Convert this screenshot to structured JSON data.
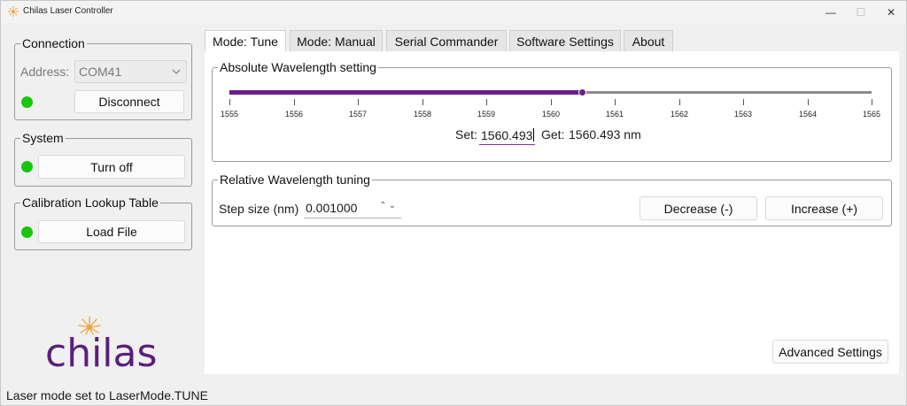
{
  "window": {
    "title": "Chilas Laser Controller",
    "minimize_icon": "—",
    "maximize_icon": "☐",
    "close_icon": "✕"
  },
  "connection": {
    "title": "Connection",
    "address_label": "Address:",
    "address_value": "COM41",
    "disconnect_label": "Disconnect",
    "status_color": "#16c60c"
  },
  "system": {
    "title": "System",
    "turn_off_label": "Turn off",
    "status_color": "#16c60c"
  },
  "calibration": {
    "title": "Calibration Lookup Table",
    "load_label": "Load File",
    "status_color": "#16c60c"
  },
  "logo": {
    "text": "chilas",
    "icon": "sun-icon",
    "color": "#5b1f7a",
    "accent": "#f2a33a"
  },
  "tabs": [
    {
      "label": "Mode: Tune",
      "active": true
    },
    {
      "label": "Mode: Manual",
      "active": false
    },
    {
      "label": "Serial Commander",
      "active": false
    },
    {
      "label": "Software Settings",
      "active": false
    },
    {
      "label": "About",
      "active": false
    }
  ],
  "absolute": {
    "title": "Absolute Wavelength setting",
    "slider_min": 1555,
    "slider_max": 1565,
    "slider_value": 1560.493,
    "tick_labels": [
      "1555",
      "1556",
      "1557",
      "1558",
      "1559",
      "1560",
      "1561",
      "1562",
      "1563",
      "1564",
      "1565"
    ],
    "set_label": "Set:",
    "set_value": "1560.493",
    "get_label": "Get:",
    "get_value": "1560.493 nm",
    "accent": "#6a1e8a"
  },
  "relative": {
    "title": "Relative Wavelength tuning",
    "step_label": "Step size (nm)",
    "step_value": "0.001000",
    "decrease_label": "Decrease (-)",
    "increase_label": "Increase (+)"
  },
  "advanced_label": "Advanced Settings",
  "status": "Laser mode set to LaserMode.TUNE"
}
